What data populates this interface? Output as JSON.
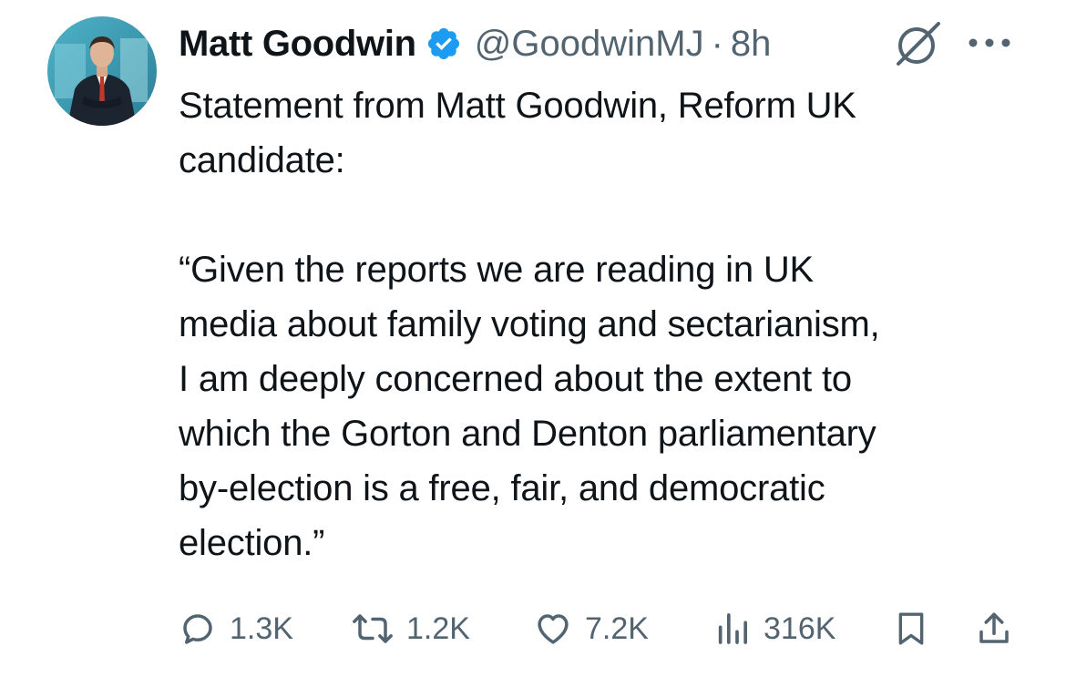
{
  "author": {
    "name": "Matt Goodwin",
    "handle": "@GoodwinMJ",
    "separator": "·",
    "time": "8h"
  },
  "tweet": {
    "text": "Statement from Matt Goodwin, Reform UK\ncandidate:\n\n“Given the reports we are reading in UK\nmedia about family voting and sectarianism,\nI am deeply concerned about the extent to\nwhich the Gorton and Denton parliamentary\nby-election is a free, fair, and democratic\nelection.”"
  },
  "actions": {
    "replies": "1.3K",
    "reposts": "1.2K",
    "likes": "7.2K",
    "views": "316K"
  },
  "icons": {
    "verified": "verified-badge-icon",
    "grok": "grok-icon",
    "more": "more-icon",
    "reply": "reply-icon",
    "repost": "repost-icon",
    "like": "heart-icon",
    "views": "views-icon",
    "bookmark": "bookmark-icon",
    "share": "share-icon"
  },
  "colors": {
    "text": "#0f1419",
    "secondary": "#536471",
    "verified": "#1d9bf0"
  }
}
